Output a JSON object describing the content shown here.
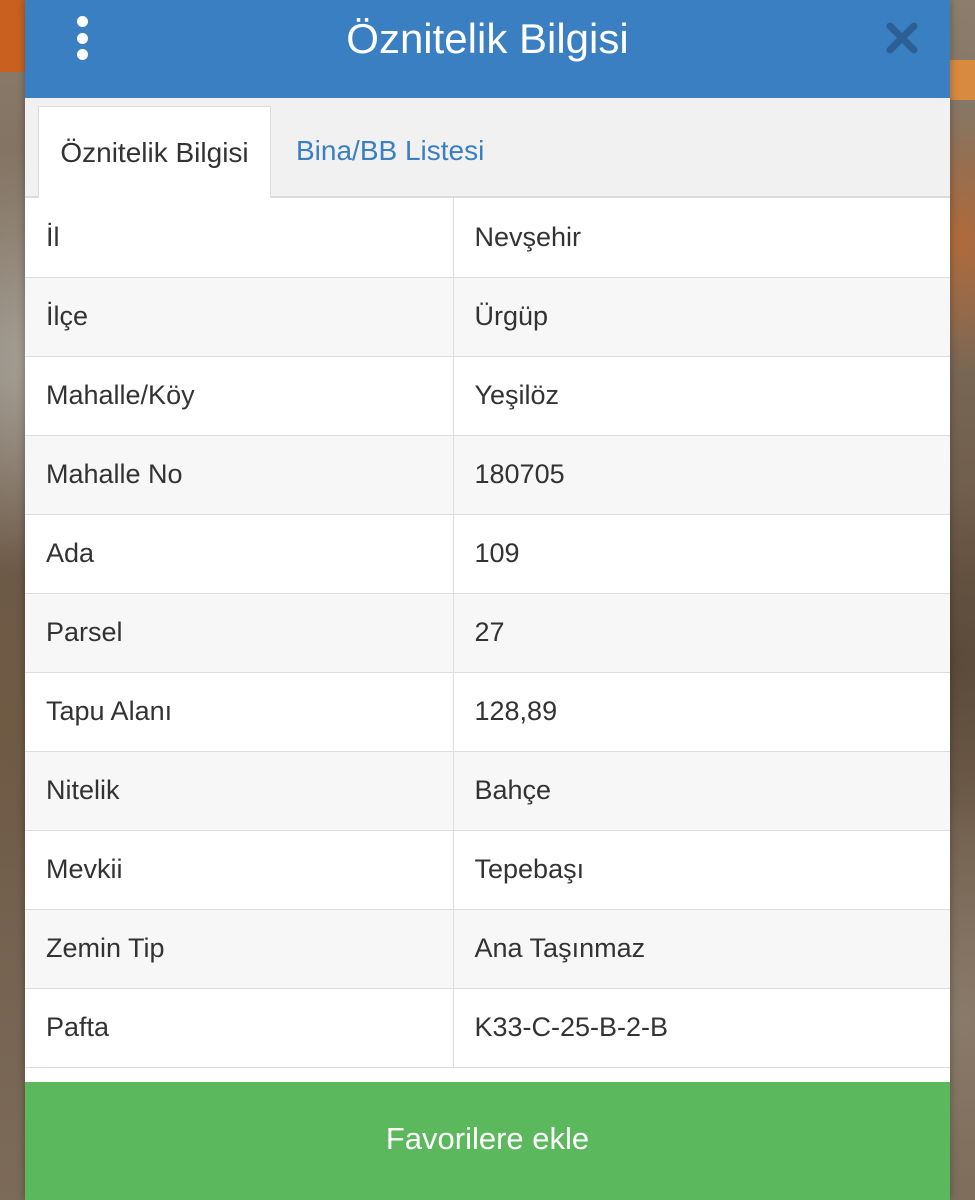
{
  "header": {
    "title": "Öznitelik Bilgisi"
  },
  "tabs": [
    {
      "label": "Öznitelik Bilgisi",
      "active": true
    },
    {
      "label": "Bina/BB Listesi",
      "active": false
    }
  ],
  "attributes": [
    {
      "key": "İl",
      "value": "Nevşehir"
    },
    {
      "key": "İlçe",
      "value": "Ürgüp"
    },
    {
      "key": "Mahalle/Köy",
      "value": "Yeşilöz"
    },
    {
      "key": "Mahalle No",
      "value": "180705"
    },
    {
      "key": "Ada",
      "value": "109"
    },
    {
      "key": "Parsel",
      "value": "27"
    },
    {
      "key": "Tapu Alanı",
      "value": "128,89"
    },
    {
      "key": "Nitelik",
      "value": "Bahçe"
    },
    {
      "key": "Mevkii",
      "value": "Tepebaşı"
    },
    {
      "key": "Zemin Tip",
      "value": "Ana Taşınmaz"
    },
    {
      "key": "Pafta",
      "value": "K33-C-25-B-2-B"
    }
  ],
  "footer": {
    "favorite_label": "Favorilere ekle"
  },
  "icons": {
    "menu": "vertical-dots-icon",
    "close": "close-icon"
  },
  "colors": {
    "header": "#3a7fc1",
    "tab_link": "#3a7fc1",
    "favorite_button": "#5cb85c"
  }
}
